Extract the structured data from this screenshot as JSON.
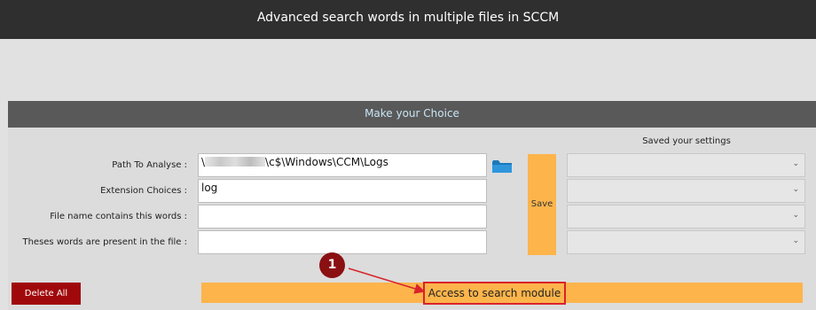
{
  "app": {
    "title": "Advanced search words in multiple files in SCCM"
  },
  "panel": {
    "title": "Make your Choice"
  },
  "form": {
    "path_label": "Path To Analyse :",
    "path_value_prefix": "\\",
    "path_value_suffix": "\\c$\\Windows\\CCM\\Logs",
    "extension_label": "Extension Choices :",
    "extension_value": "log",
    "filename_label": "File name contains this words :",
    "filename_value": "",
    "words_label": "Theses words are present in the file :",
    "words_value": ""
  },
  "icons": {
    "folder": "folder-icon",
    "chevron": "chevron-down-icon"
  },
  "saved": {
    "title": "Saved your settings",
    "save_label": "Save"
  },
  "actions": {
    "delete_all": "Delete All",
    "search_module": "Access to search module"
  },
  "annotation": {
    "marker": "1"
  },
  "colors": {
    "accent_orange": "#fdb44b",
    "delete_red": "#a0090b",
    "annotation_red": "#d9232b",
    "marker_red": "#8a1012"
  }
}
